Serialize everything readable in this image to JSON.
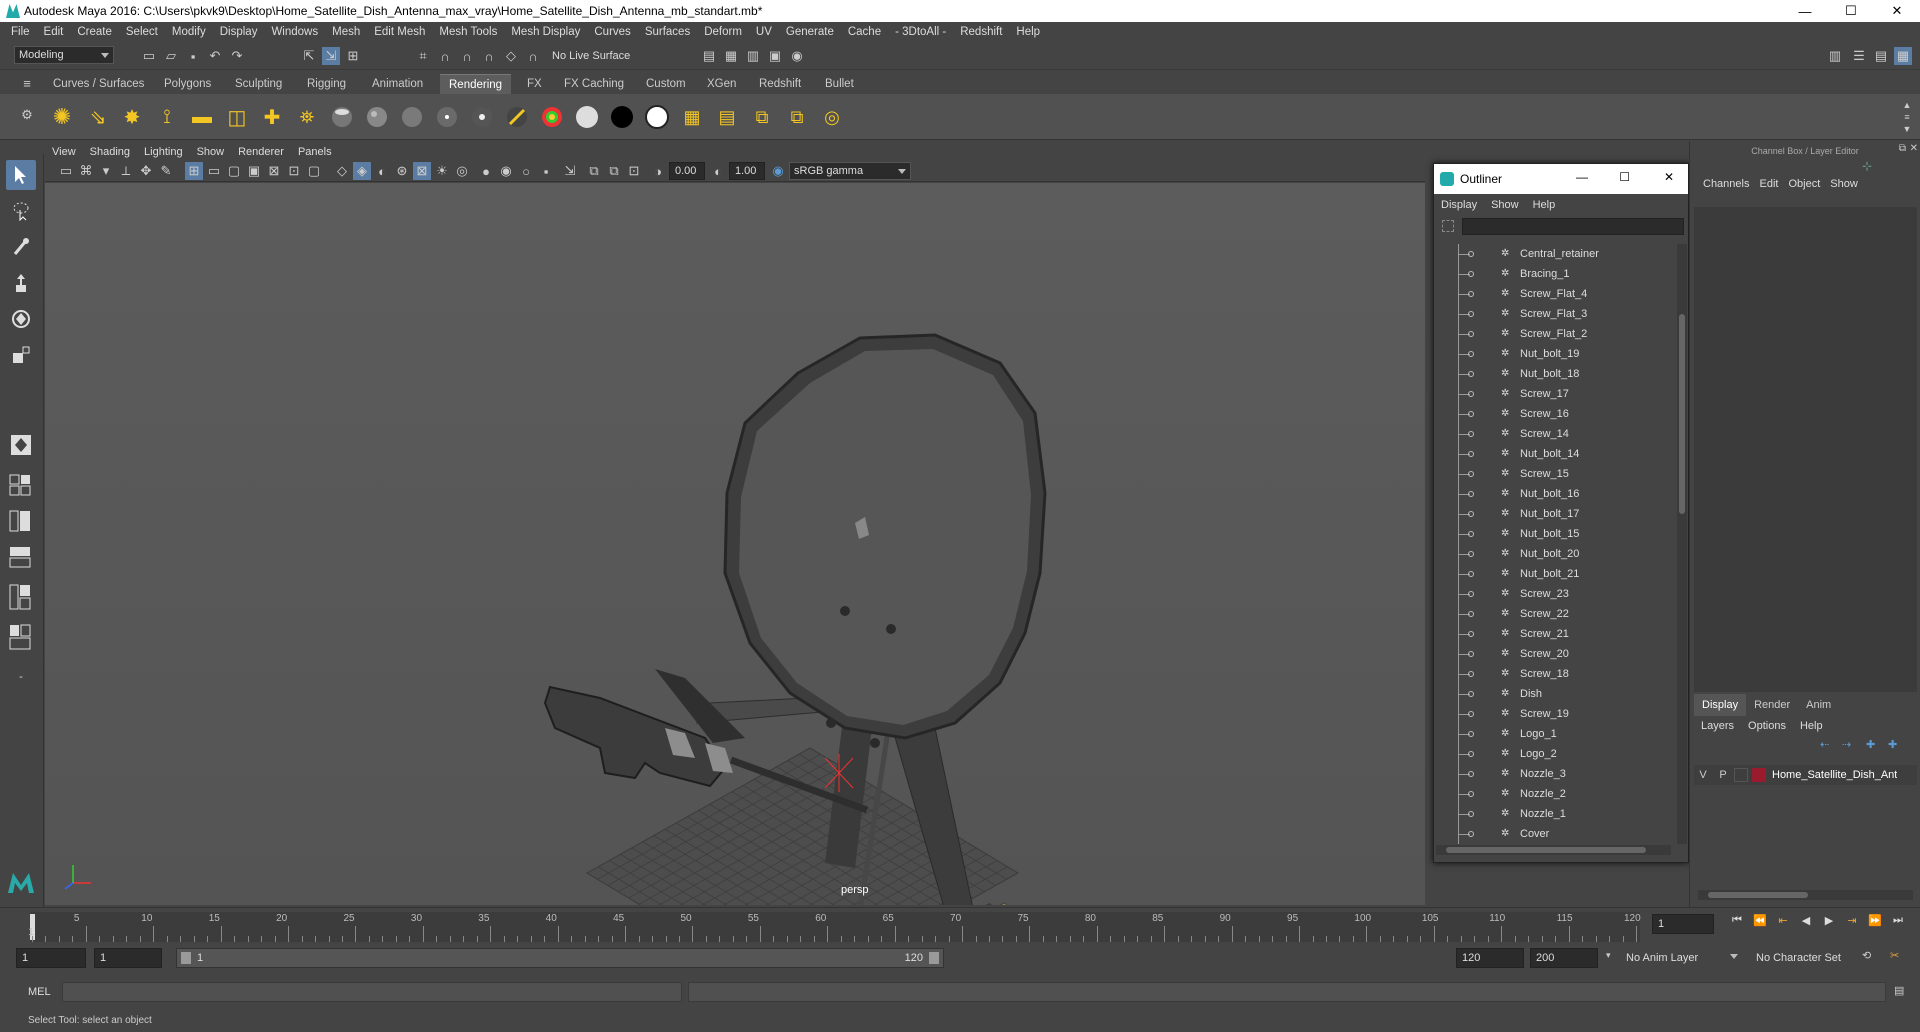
{
  "window": {
    "title": "Autodesk Maya 2016: C:\\Users\\pkvk9\\Desktop\\Home_Satellite_Dish_Antenna_max_vray\\Home_Satellite_Dish_Antenna_mb_standart.mb*",
    "minimize": "—",
    "maximize": "☐",
    "close": "✕"
  },
  "menubar": [
    "File",
    "Edit",
    "Create",
    "Select",
    "Modify",
    "Display",
    "Windows",
    "Mesh",
    "Edit Mesh",
    "Mesh Tools",
    "Mesh Display",
    "Curves",
    "Surfaces",
    "Deform",
    "UV",
    "Generate",
    "Cache",
    "- 3DtoAll -",
    "Redshift",
    "Help"
  ],
  "statusline": {
    "mode": "Modeling",
    "live_surface": "No Live Surface"
  },
  "shelf_tabs": [
    "Curves / Surfaces",
    "Polygons",
    "Sculpting",
    "Rigging",
    "Animation",
    "Rendering",
    "FX",
    "FX Caching",
    "Custom",
    "XGen",
    "Redshift",
    "Bullet"
  ],
  "active_shelf_tab": "Rendering",
  "viewport": {
    "menu": [
      "View",
      "Shading",
      "Lighting",
      "Show",
      "Renderer",
      "Panels"
    ],
    "exposure": "0.00",
    "gamma": "1.00",
    "color_space": "sRGB gamma",
    "camera_label": "persp"
  },
  "outliner": {
    "title": "Outliner",
    "menu": [
      "Display",
      "Show",
      "Help"
    ],
    "items": [
      "Central_retainer",
      "Bracing_1",
      "Screw_Flat_4",
      "Screw_Flat_3",
      "Screw_Flat_2",
      "Nut_bolt_19",
      "Nut_bolt_18",
      "Screw_17",
      "Screw_16",
      "Screw_14",
      "Nut_bolt_14",
      "Screw_15",
      "Nut_bolt_16",
      "Nut_bolt_17",
      "Nut_bolt_15",
      "Nut_bolt_20",
      "Nut_bolt_21",
      "Screw_23",
      "Screw_22",
      "Screw_21",
      "Screw_20",
      "Screw_18",
      "Dish",
      "Screw_19",
      "Logo_1",
      "Logo_2",
      "Nozzle_3",
      "Nozzle_2",
      "Nozzle_1",
      "Cover"
    ]
  },
  "channel_box": {
    "header": "Channel Box / Layer Editor",
    "menu": [
      "Channels",
      "Edit",
      "Object",
      "Show"
    ],
    "layer_tabs": [
      "Display",
      "Render",
      "Anim"
    ],
    "active_layer_tab": "Display",
    "layer_menu": [
      "Layers",
      "Options",
      "Help"
    ],
    "layer": {
      "v": "V",
      "p": "P",
      "name": "Home_Satellite_Dish_Ant",
      "color": "#9b1b2e"
    }
  },
  "timeline": {
    "ticks": [
      "5",
      "10",
      "15",
      "20",
      "25",
      "30",
      "35",
      "40",
      "45",
      "50",
      "55",
      "60",
      "65",
      "70",
      "75",
      "80",
      "85",
      "90",
      "95",
      "100",
      "105",
      "110",
      "115",
      "120"
    ],
    "start_label": "1",
    "current_frame": "1"
  },
  "range": {
    "start": "1",
    "playback_start": "1",
    "slider_start": "1",
    "slider_end": "120",
    "playback_end": "120",
    "end": "200",
    "anim_layer": "No Anim Layer",
    "character_set": "No Character Set"
  },
  "mel": {
    "label": "MEL"
  },
  "help_line": "Select Tool: select an object",
  "colors": {
    "accent": "#5b7da3",
    "active_tab": "#5d5d5d"
  }
}
